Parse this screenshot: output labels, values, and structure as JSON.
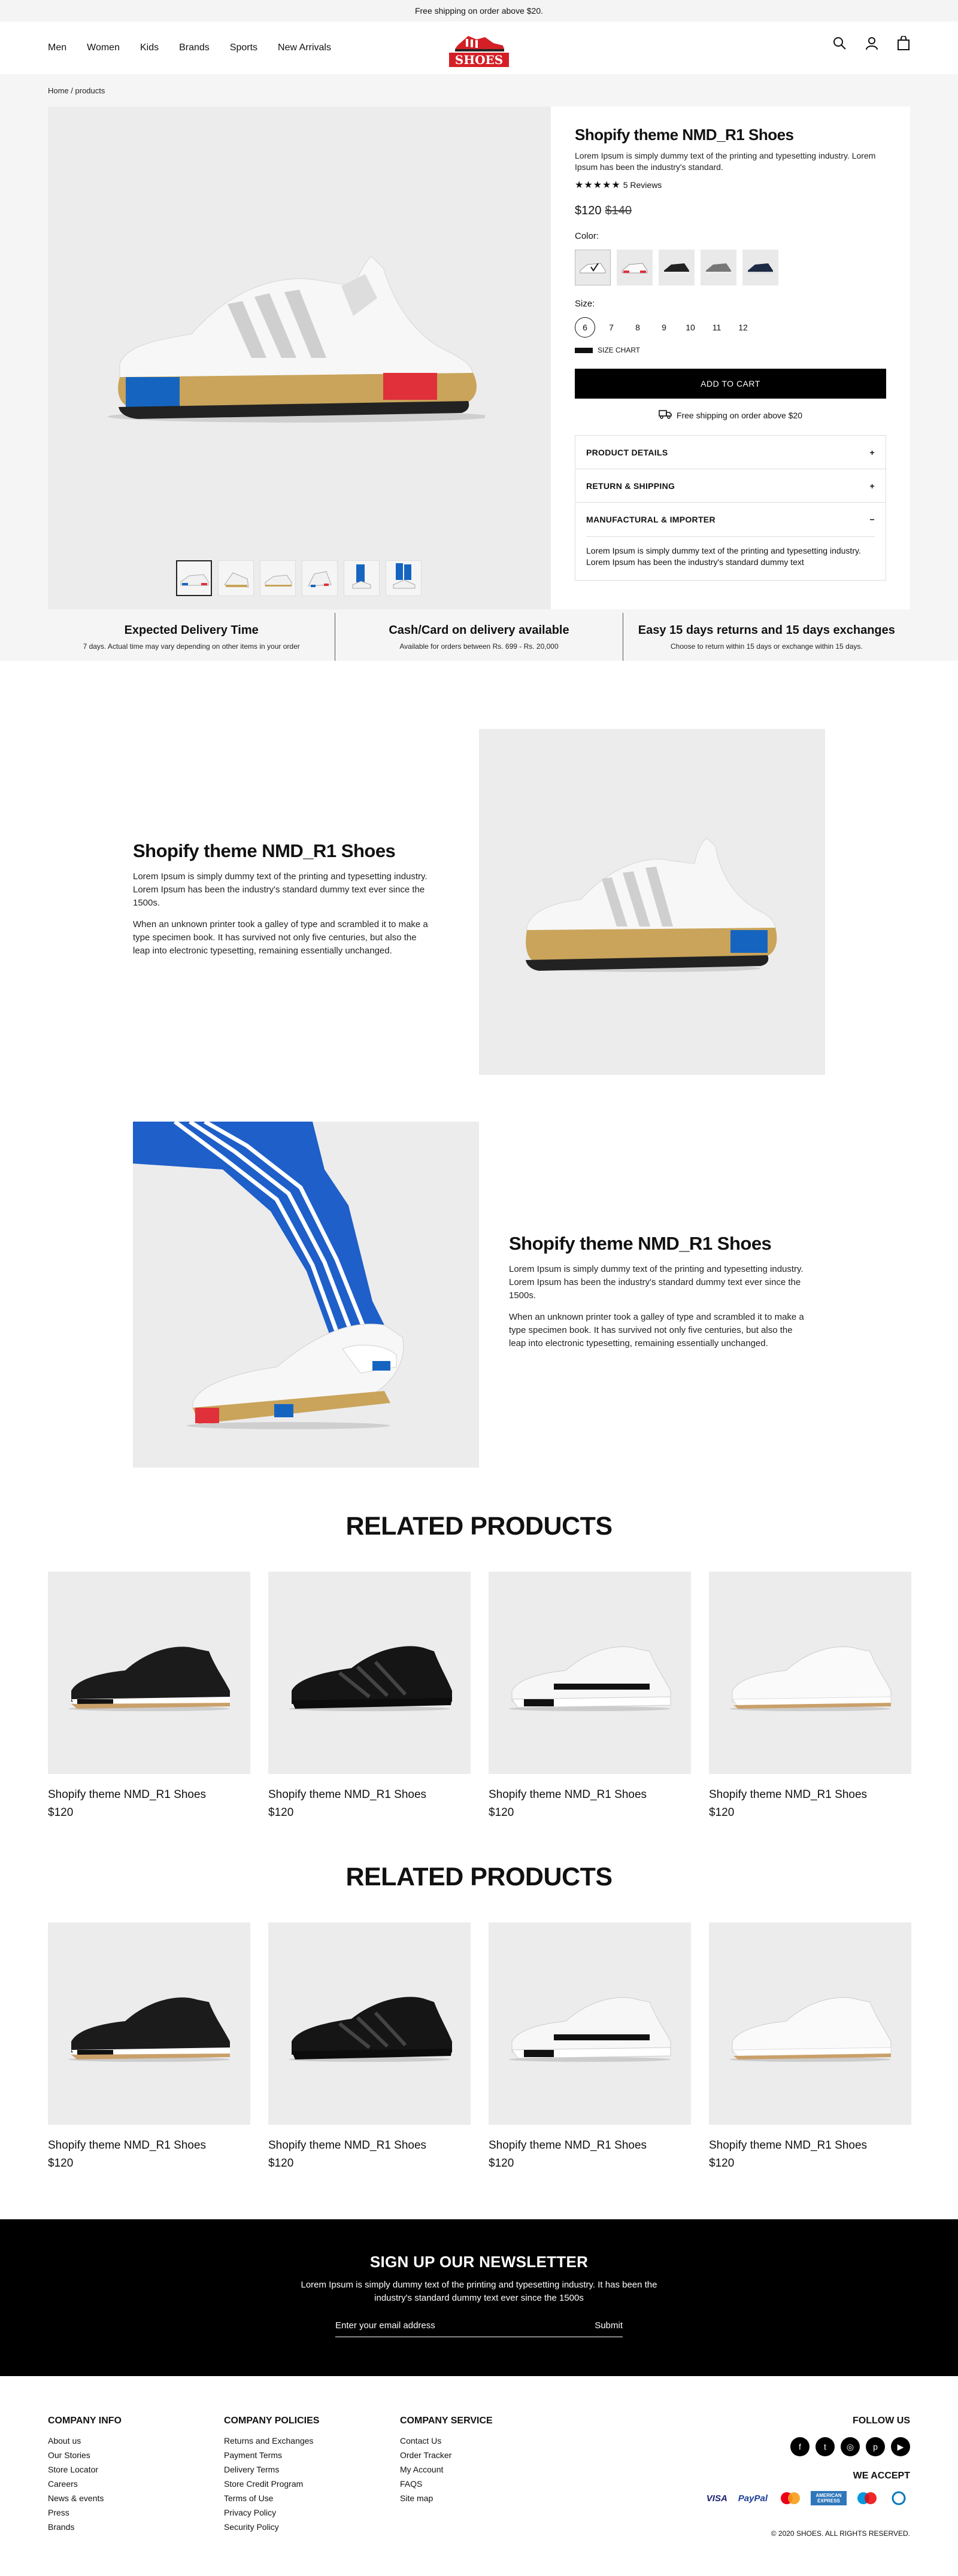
{
  "topbar": {
    "text": "Free shipping on order above $20."
  },
  "nav": {
    "items": [
      "Men",
      "Women",
      "Kids",
      "Brands",
      "Sports",
      "New Arrivals"
    ]
  },
  "logo": {
    "text": "SHOES"
  },
  "header_icons": [
    "search-icon",
    "user-icon",
    "bag-icon"
  ],
  "breadcrumb": "Home / products",
  "product": {
    "title": "Shopify theme NMD_R1 Shoes",
    "desc": "Lorem Ipsum is simply dummy text of the printing and typesetting industry. Lorem Ipsum has been the industry's standard.",
    "stars": "★★★★★",
    "reviews": "5 Reviews",
    "price": "$120",
    "old_price": "$140",
    "color_label": "Color:",
    "size_label": "Size:",
    "sizes": [
      "6",
      "7",
      "8",
      "9",
      "10",
      "11",
      "12"
    ],
    "size_chart": "SIZE CHART",
    "add_to_cart": "ADD TO CART",
    "shipping": "Free shipping on order above $20",
    "accordion": [
      {
        "title": "PRODUCT DETAILS",
        "icon": "+"
      },
      {
        "title": "RETURN & SHIPPING",
        "icon": "+"
      },
      {
        "title": "MANUFACTURAL & IMPORTER",
        "icon": "−"
      }
    ],
    "accordion_body": "Lorem Ipsum is simply dummy text of the printing and typesetting industry. Lorem Ipsum has been the industry's standard dummy text"
  },
  "features": [
    {
      "title": "Expected Delivery Time",
      "sub": "7 days. Actual time may vary depending on other items in your order"
    },
    {
      "title": "Cash/Card on delivery available",
      "sub": "Available for orders between Rs. 699 - Rs. 20,000"
    },
    {
      "title": "Easy 15 days returns and 15 days exchanges",
      "sub": "Choose to return within 15 days or exchange within 15 days."
    }
  ],
  "story": {
    "title": "Shopify theme NMD_R1 Shoes",
    "p1": "Lorem Ipsum is simply dummy text of the printing and typesetting industry. Lorem Ipsum has been the industry's standard dummy text ever since the 1500s.",
    "p2": "When an unknown printer took a galley of type and scrambled it to make a type specimen book. It has survived not only five centuries, but also the leap into electronic typesetting, remaining essentially unchanged."
  },
  "related1": {
    "title": "RELATED PRODUCTS",
    "items": [
      {
        "name": "Shopify theme NMD_R1 Shoes",
        "price": "$120"
      },
      {
        "name": "Shopify theme NMD_R1 Shoes",
        "price": "$120"
      },
      {
        "name": "Shopify theme NMD_R1 Shoes",
        "price": "$120"
      },
      {
        "name": "Shopify theme NMD_R1 Shoes",
        "price": "$120"
      }
    ]
  },
  "related2": {
    "title": "RELATED PRODUCTS",
    "items": [
      {
        "name": "Shopify theme NMD_R1 Shoes",
        "price": "$120"
      },
      {
        "name": "Shopify theme NMD_R1 Shoes",
        "price": "$120"
      },
      {
        "name": "Shopify theme NMD_R1 Shoes",
        "price": "$120"
      },
      {
        "name": "Shopify theme NMD_R1 Shoes",
        "price": "$120"
      }
    ]
  },
  "newsletter": {
    "title": "SIGN UP OUR NEWSLETTER",
    "text": "Lorem Ipsum is simply dummy text of the printing and typesetting industry. It has been the industry's standard dummy text ever since the 1500s",
    "placeholder": "Enter your email address",
    "submit": "Submit"
  },
  "footer": {
    "col1": {
      "title": "COMPANY INFO",
      "links": [
        "About us",
        "Our Stories",
        "Store Locator",
        "Careers",
        "News & events",
        "Press",
        "Brands"
      ]
    },
    "col2": {
      "title": "COMPANY POLICIES",
      "links": [
        "Returns and Exchanges",
        "Payment Terms",
        "Delivery Terms",
        "Store Credit Program",
        "Terms of Use",
        "Privacy Policy",
        "Security Policy"
      ]
    },
    "col3": {
      "title": "COMPANY SERVICE",
      "links": [
        "Contact Us",
        "Order Tracker",
        "My Account",
        "FAQS",
        "Site map"
      ]
    },
    "follow": "FOLLOW US",
    "accept": "WE ACCEPT",
    "pay": [
      "VISA",
      "PayPal",
      "MC",
      "AMERICAN EXPRESS",
      "Maestro",
      "DC"
    ],
    "copyright": "© 2020 SHOES. ALL RIGHTS RESERVED."
  },
  "colors": {
    "accent": "#d41f26",
    "dark": "#000000",
    "panel": "#ececec"
  }
}
